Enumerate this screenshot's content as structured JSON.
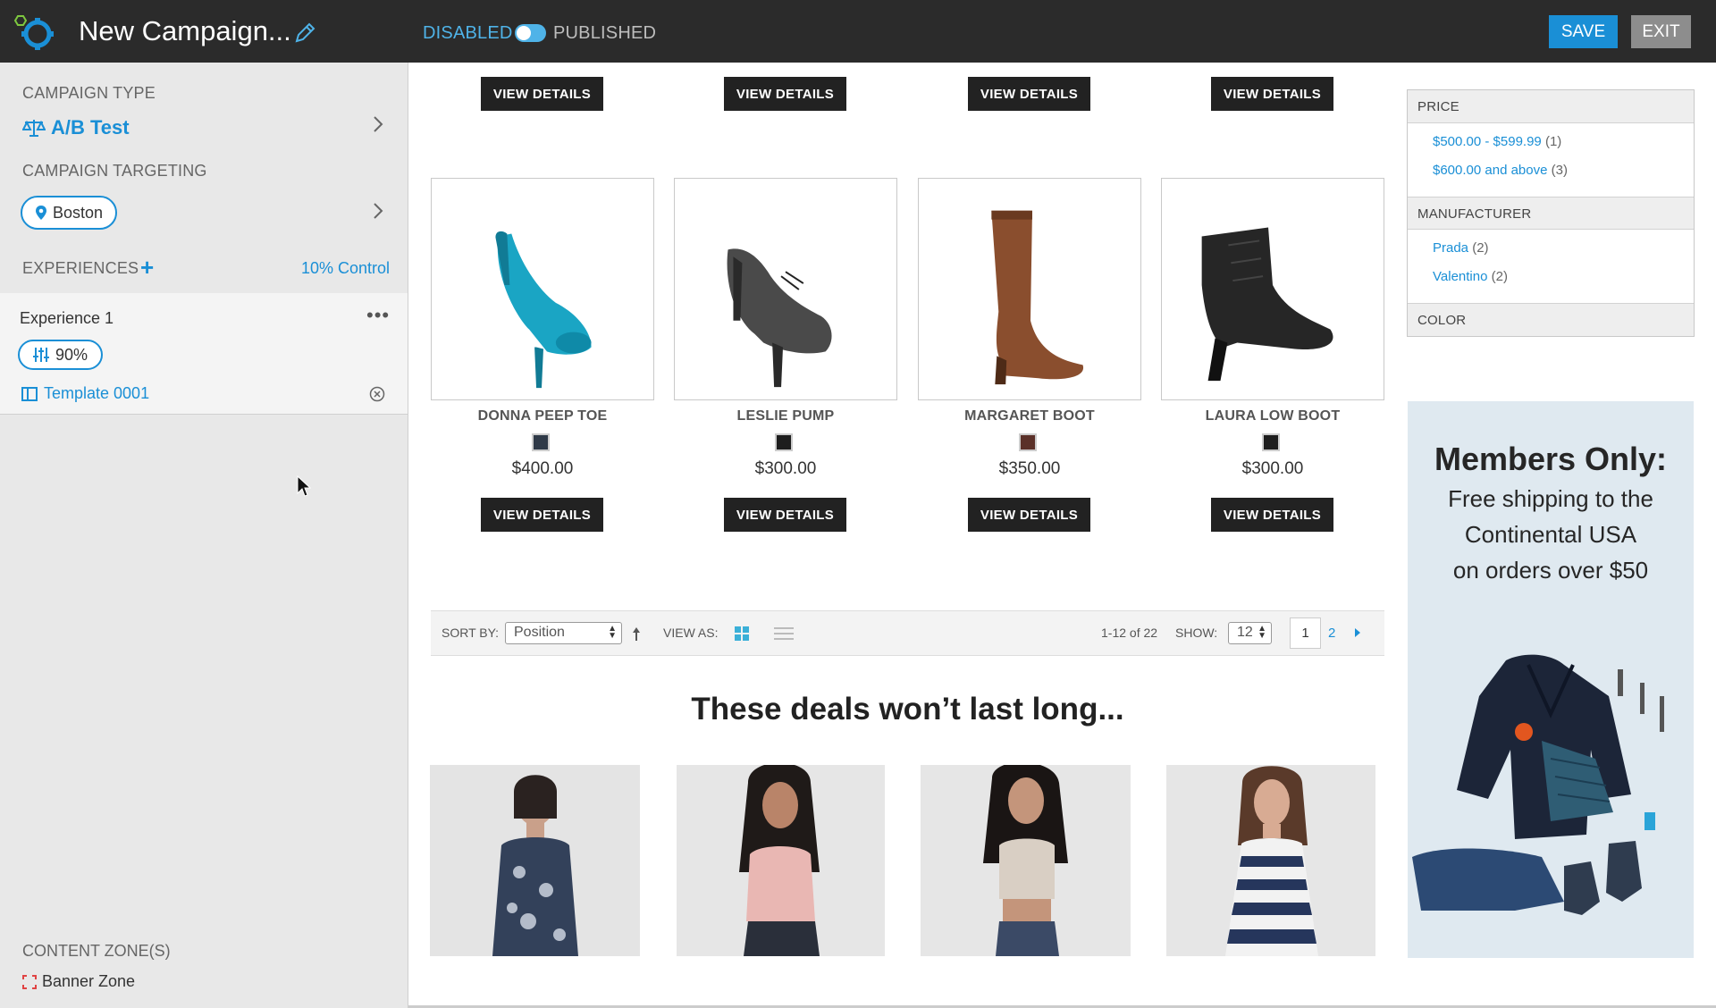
{
  "header": {
    "campaign_name": "New Campaign...",
    "status_off": "DISABLED",
    "status_on": "PUBLISHED",
    "save": "SAVE",
    "exit": "EXIT"
  },
  "sidebar": {
    "type_label": "CAMPAIGN TYPE",
    "type_value": "A/B Test",
    "targeting_label": "CAMPAIGN TARGETING",
    "location": "Boston",
    "experiences_label": "EXPERIENCES",
    "add_symbol": "+",
    "control": "10% Control",
    "experience": {
      "name": "Experience 1",
      "menu": "•••",
      "percent": "90%",
      "template": "Template 0001"
    },
    "zone_label": "CONTENT ZONE(S)",
    "zone_item": "Banner Zone"
  },
  "products": {
    "button_label": "VIEW DETAILS",
    "items": [
      {
        "name": "DONNA PEEP TOE",
        "price": "$400.00",
        "swatch": "#2f3a48"
      },
      {
        "name": "LESLIE PUMP",
        "price": "$300.00",
        "swatch": "#1e1e1e"
      },
      {
        "name": "MARGARET BOOT",
        "price": "$350.00",
        "swatch": "#5b3129"
      },
      {
        "name": "LAURA LOW BOOT",
        "price": "$300.00",
        "swatch": "#1e1e1e"
      }
    ]
  },
  "toolbar": {
    "sort_label": "SORT BY:",
    "sort_value": "Position",
    "view_label": "VIEW AS:",
    "count": "1-12 of 22",
    "show_label": "SHOW:",
    "show_value": "12",
    "page_current": "1",
    "page_next": "2"
  },
  "deals": {
    "title": "These deals won’t last long..."
  },
  "filters": {
    "price_label": "PRICE",
    "price_options": [
      {
        "label": "$500.00 - $599.99",
        "count": "(1)"
      },
      {
        "label": "$600.00 and above",
        "count": "(3)"
      }
    ],
    "manufacturer_label": "MANUFACTURER",
    "manufacturer_options": [
      {
        "label": "Prada",
        "count": "(2)"
      },
      {
        "label": "Valentino",
        "count": "(2)"
      }
    ],
    "color_label": "COLOR"
  },
  "banner": {
    "title": "Members Only:",
    "line1": "Free shipping to the",
    "line2": "Continental USA",
    "line3": "on orders over $50"
  },
  "colors": {
    "accent": "#1a8fd6",
    "topbar": "#2b2b2b",
    "sidebar": "#e8e8e8"
  }
}
